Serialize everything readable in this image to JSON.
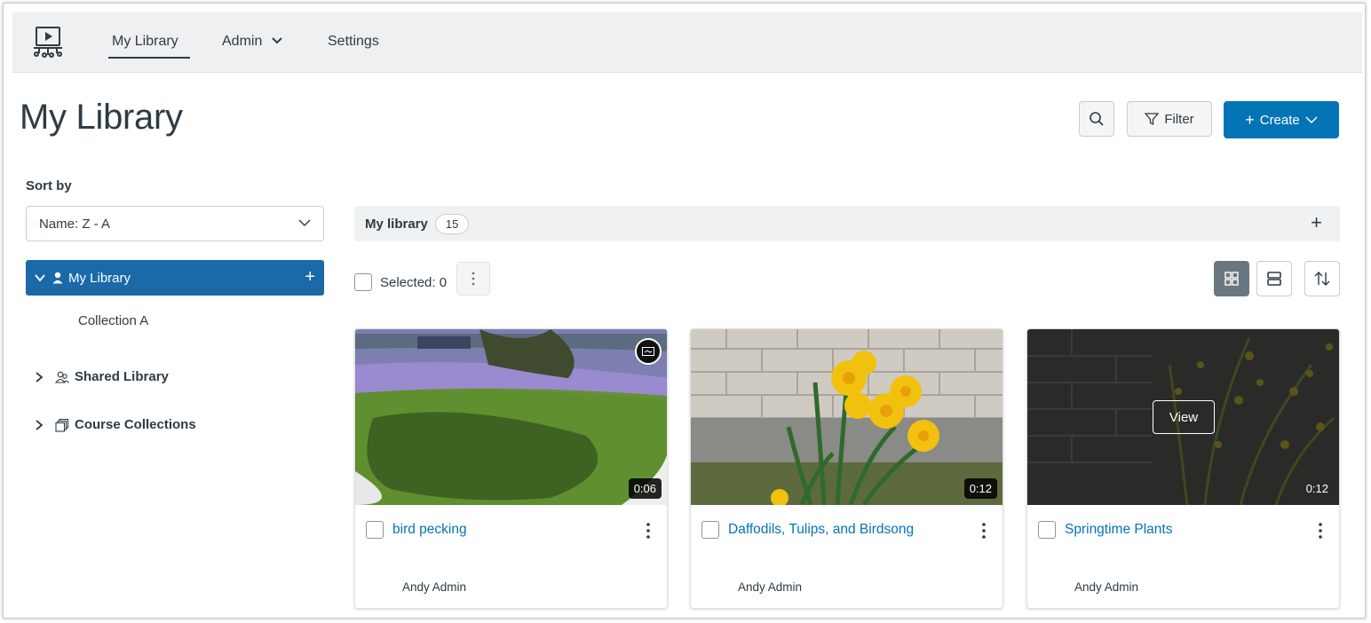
{
  "nav": {
    "my_library": "My Library",
    "admin": "Admin",
    "settings": "Settings"
  },
  "page": {
    "title": "My Library"
  },
  "toolbar": {
    "filter_label": "Filter",
    "create_label": "Create"
  },
  "sort": {
    "label": "Sort by",
    "value": "Name: Z - A"
  },
  "tree": {
    "active_label": "My Library",
    "sub_item": "Collection A",
    "shared_label": "Shared Library",
    "course_label": "Course Collections"
  },
  "library_bar": {
    "label": "My library",
    "count": "15"
  },
  "selection": {
    "label": "Selected: 0"
  },
  "cards": [
    {
      "title": "bird pecking",
      "owner": "Andy Admin",
      "duration": "0:06"
    },
    {
      "title": "Daffodils, Tulips, and Birdsong",
      "owner": "Andy Admin",
      "duration": "0:12"
    },
    {
      "title": "Springtime Plants",
      "owner": "Andy Admin",
      "duration": "0:12",
      "overlay": "View"
    }
  ],
  "colors": {
    "accent": "#0374b5",
    "tree_active": "#1c69a8",
    "nav_bg": "#eff0f1",
    "text": "#2d3b45"
  },
  "icons": {
    "logo": "presentation-screen-icon",
    "search": "search-icon",
    "filter": "filter-funnel-icon",
    "grid_view": "grid-view-icon",
    "list_view": "list-view-icon",
    "sort": "sort-arrows-icon"
  }
}
